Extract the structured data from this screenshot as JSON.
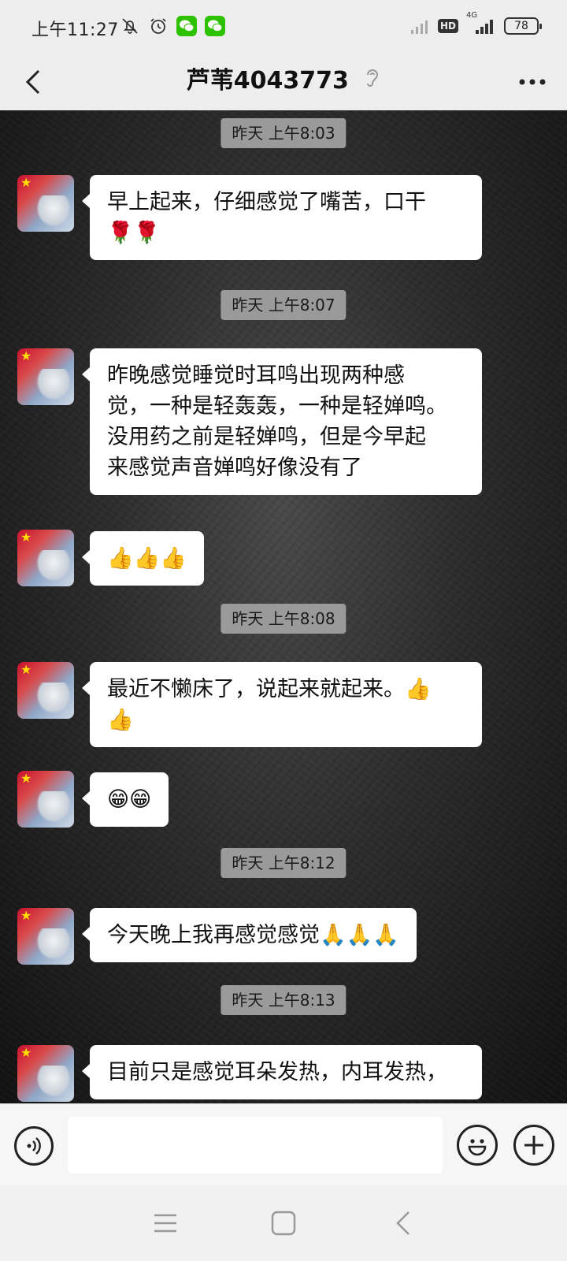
{
  "status_bar": {
    "time": "上午11:27",
    "network_type": "4G",
    "hd_label": "HD",
    "battery_level": "78"
  },
  "header": {
    "title": "芦苇4043773"
  },
  "messages": [
    {
      "type": "timestamp",
      "text": "昨天 上午8:03"
    },
    {
      "type": "message",
      "lines": [
        "早上起来，仔细感觉了嘴苦，口干",
        "🌹🌹"
      ]
    },
    {
      "type": "timestamp",
      "text": "昨天 上午8:07"
    },
    {
      "type": "message",
      "lines": [
        "昨晚感觉睡觉时耳鸣出现两种感",
        "觉，一种是轻轰轰，一种是轻婵鸣。",
        "没用药之前是轻婵鸣，但是今早起",
        "来感觉声音婵鸣好像没有了"
      ]
    },
    {
      "type": "message",
      "lines": [
        "👍👍👍"
      ]
    },
    {
      "type": "timestamp",
      "text": "昨天 上午8:08"
    },
    {
      "type": "message",
      "lines": [
        "最近不懒床了，说起来就起来。👍",
        "👍"
      ]
    },
    {
      "type": "message",
      "lines": [
        "😁😁"
      ]
    },
    {
      "type": "timestamp",
      "text": "昨天 上午8:12"
    },
    {
      "type": "message",
      "lines": [
        "今天晚上我再感觉感觉🙏🙏🙏"
      ]
    },
    {
      "type": "timestamp",
      "text": "昨天 上午8:13"
    },
    {
      "type": "message",
      "lines": [
        "目前只是感觉耳朵发热，内耳发热，"
      ]
    }
  ],
  "input": {
    "value": "",
    "placeholder": ""
  },
  "icons": {
    "back": "back-arrow-icon",
    "ear": "ear-icon",
    "more": "more-dots-icon",
    "voice": "voice-icon",
    "emoji": "emoji-icon",
    "plus": "plus-icon",
    "nav_menu": "menu-icon",
    "nav_home": "home-icon",
    "nav_back": "nav-back-icon"
  },
  "colors": {
    "bubble": "#ffffff",
    "timestamp_bg": "#9a9a9a",
    "header_bg": "#ededed",
    "wechat_green": "#2dc100"
  }
}
